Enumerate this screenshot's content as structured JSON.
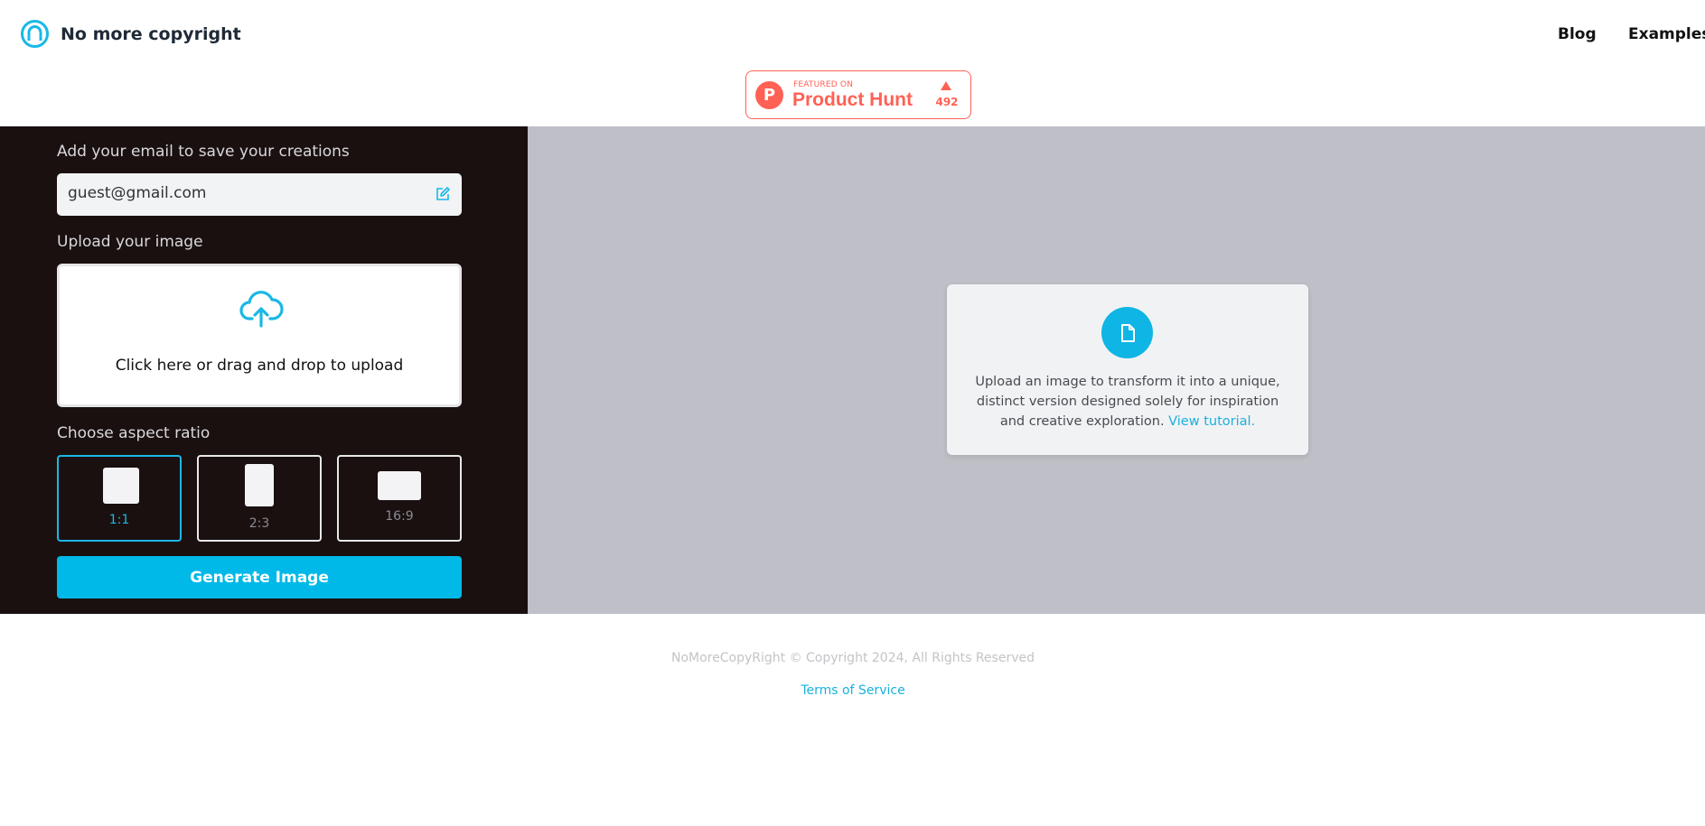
{
  "header": {
    "brand_name": "No more copyright",
    "nav": [
      {
        "label": "Blog"
      },
      {
        "label": "Examples"
      }
    ]
  },
  "product_hunt": {
    "featured_label": "FEATURED ON",
    "title": "Product Hunt",
    "logo_letter": "P",
    "upvotes": "492"
  },
  "sidebar": {
    "email_label": "Add your email to save your creations",
    "email_value": "guest@gmail.com",
    "upload_label": "Upload your image",
    "upload_text": "Click here or drag and drop to upload",
    "ratio_label": "Choose aspect ratio",
    "ratios": [
      {
        "label": "1:1",
        "selected": true
      },
      {
        "label": "2:3",
        "selected": false
      },
      {
        "label": "16:9",
        "selected": false
      }
    ],
    "generate_label": "Generate Image"
  },
  "preview": {
    "info_text": "Upload an image to transform it into a unique, distinct version designed solely for inspiration and creative exploration.",
    "tutorial_link": "View tutorial."
  },
  "footer": {
    "copyright": "NoMoreCopyRight © Copyright 2024, All Rights Reserved",
    "terms": "Terms of Service"
  },
  "colors": {
    "accent": "#00b9e8",
    "sidebar_bg": "#1a1010",
    "preview_bg": "#bfbfc7",
    "product_hunt": "#ff6154"
  }
}
